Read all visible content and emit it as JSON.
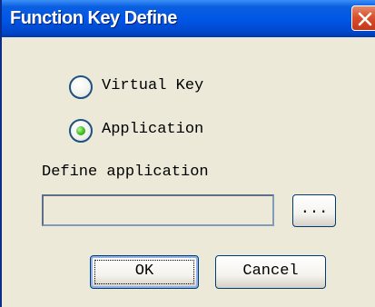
{
  "window": {
    "title": "Function Key Define"
  },
  "title_bar": {
    "close_icon": "close-icon",
    "close_color": "#d9512c",
    "bar_color": "#0055e5"
  },
  "options": {
    "selected": "application",
    "virtual_key": {
      "label": "Virtual Key",
      "checked": false
    },
    "application": {
      "label": "Application",
      "checked": true
    }
  },
  "define_application": {
    "label": "Define application",
    "value": ""
  },
  "buttons": {
    "browse": "...",
    "ok": "OK",
    "cancel": "Cancel"
  },
  "colors": {
    "dialog_bg": "#ece9d8",
    "radio_selected": "#3fbf20"
  }
}
